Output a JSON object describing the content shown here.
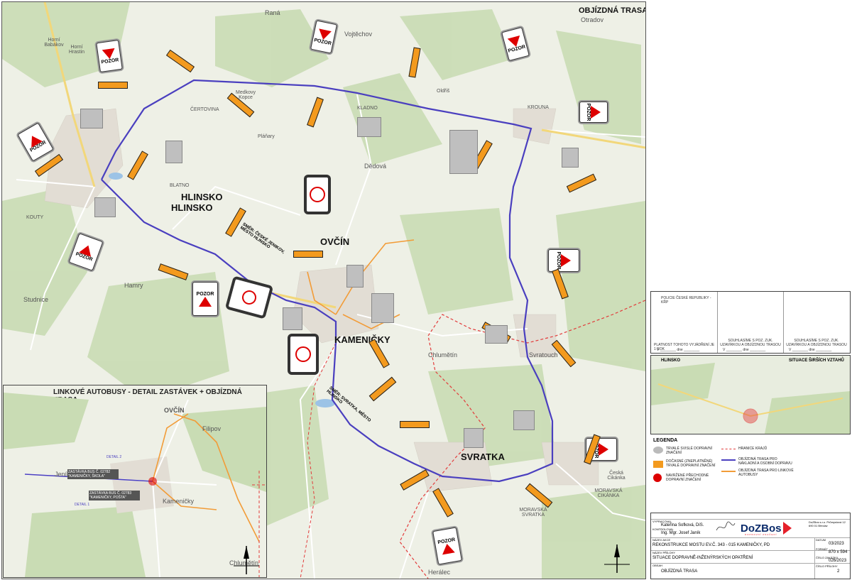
{
  "map_title": "OBJÍZDNÁ TRASA",
  "towns": {
    "rana": "Raná",
    "vojtechov": "Vojtěchov",
    "otradov": "Otradov",
    "horni_babakov": "Horní Babákov",
    "horni_hrastin": "Horní Hrastin",
    "certovina": "ČERTOVINA",
    "medkovy_kopce": "Medkovy Kopce",
    "kladno": "KLADNO",
    "oldris": "Oldřiš",
    "krouna": "KROUNA",
    "planary": "Pláňary",
    "dedova": "Dědová",
    "blatno": "BLATNO",
    "hlinsko1": "HLINSKO",
    "hlinsko2": "HLINSKO",
    "kouty": "KOUTY",
    "ovcin": "OVČÍN",
    "hamry": "Hamry",
    "studnice": "Studnice",
    "kamenicky": "KAMENIČKY",
    "chlumetin": "Chlumětín",
    "svratouch": "Svratouch",
    "svratka": "SVRATKA",
    "ceska_cikanka": "Česká Cikánka",
    "moravska_cikanka": "MORAVSKÁ CIKÁNKA",
    "moravska_svratka": "MORAVSKÁ SVRATKA",
    "heralec": "Herálec"
  },
  "signs": {
    "pozor": "POZOR",
    "smer_ceske_jeniko": "SMĚR: ČESKÉ JENIKOV, MĚSTO HLINSKO",
    "smer_svratka": "SMĚR: SVRATKA, MĚSTO HLINSKO"
  },
  "inset": {
    "title": "LINKOVÉ AUTOBUSY - DETAIL ZASTÁVEK + OBJÍZDNÁ TRASA",
    "ovcin": "OVČÍN",
    "filipov": "Filipov",
    "jenikov": "Jeníkov",
    "kamenicky": "Kameničky",
    "chlumetin": "Chlumětín",
    "stop1": "ZASTÁVKA BUS Č. 02782 \"KAMENIČKY, ŠKOLA\"",
    "stop2": "ZASTÁVKA BUS Č. 02783 \"KAMENIČKY, POŠTA\"",
    "detail1": "DETAIL 1",
    "detail2": "DETAIL 2"
  },
  "approvals": {
    "col1_title": "POLICIE ČESKÉ REPUBLIKY - KŘP",
    "col1_sub": "PLATNOST TOHOTO VYJÁDŘENÍ JE 1 ROK",
    "col2_sub": "SOUHLASÍME S POZ. ZUK. UZAVÍRKOU A OBJÍZDNOU TRASOU",
    "col3_sub": "SOUHLASÍME S POZ. ZUK. UZAVÍRKOU A OBJÍZDNOU TRASOU",
    "date_label": "V ________ dne ________"
  },
  "wider": {
    "title": "SITUACE ŠIRŠÍCH VZTAHŮ",
    "hlinsko": "HLINSKO"
  },
  "legend": {
    "title": "LEGENDA",
    "items": [
      "TRVALÉ SVISLÉ DOPRAVNÍ ZNAČENÍ",
      "DOČASNÉ (ZNEPLATNĚNÉ) TRVALÉ DOPRAVNÍ ZNAČENÍ",
      "NAVRŽENÉ PŘECHODNÉ DOPRAVNÍ ZNAČENÍ",
      "HRANICE KRAJŮ",
      "OBJÍZDNÁ TRASA PRO NÁKLADNÍ A OSOBNÍ DOPRAVU",
      "OBJÍZDNÁ TRASA PRO LINKOVÉ AUTOBUSY"
    ]
  },
  "title_block": {
    "zpracoval_label": "VYPRACOVAL",
    "zpracoval": "Kateřina Sofková, DiS.",
    "kontroloval_label": "KONTROLOVAL",
    "kontroloval": "Ing. Mgr. Josef Janík",
    "company": "DoZBos",
    "company_sub": "DOPRAVNÍ ZNAČENÍ",
    "company_addr": "DoZBos s.r.o. Průmyslová 12 690 01 Břeclav",
    "akce_label": "NÁZEV AKCE",
    "akce": "REKONSTRUKCE MOSTU EV.Č. 343 - 015 KAMENIČKY, PD",
    "vykres_label": "NÁZEV PŘÍLOHY",
    "vykres": "SITUACE DOPRAVNĚ-INŽENÝRSKÝCH OPATŘENÍ",
    "obsah_label": "OBSAH",
    "obsah": "OBJÍZDNÁ TRASA",
    "datum_label": "DATUM",
    "datum": "03/2023",
    "format_label": "FORMÁT",
    "format": "870 x 594",
    "zakazka_label": "ČÍSLO ZAKÁZKY",
    "zakazka": "026/2023",
    "priloha_label": "ČÍSLO PŘÍLOHY",
    "priloha": "2"
  },
  "colors": {
    "detour": "#4a3fbf",
    "bus_route": "#f29c38",
    "region_border": "#e23b3b",
    "temp_sign": "#f39a1e"
  }
}
